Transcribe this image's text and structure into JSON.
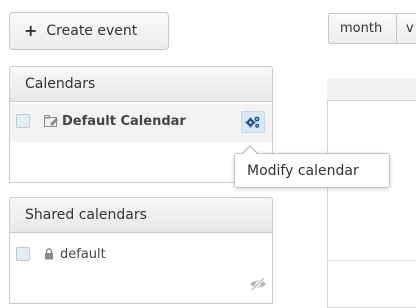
{
  "toolbar": {
    "create_event_label": "Create event",
    "create_event_icon": "plus-icon",
    "view_month_label": "month",
    "view_next_label": "v"
  },
  "calendars_panel": {
    "title": "Calendars",
    "items": [
      {
        "label": "Default Calendar",
        "icon": "calendar-edit-icon",
        "action_icon": "gear-icon"
      }
    ],
    "tooltip": "Modify calendar"
  },
  "shared_panel": {
    "title": "Shared calendars",
    "items": [
      {
        "label": "default",
        "icon": "lock-icon"
      }
    ],
    "footer_icon": "eye-hidden-icon"
  },
  "colors": {
    "checkbox_fill": "#e3eef0",
    "action_button_fill": "#d8e8f5",
    "gear_color": "#1e4f86"
  }
}
